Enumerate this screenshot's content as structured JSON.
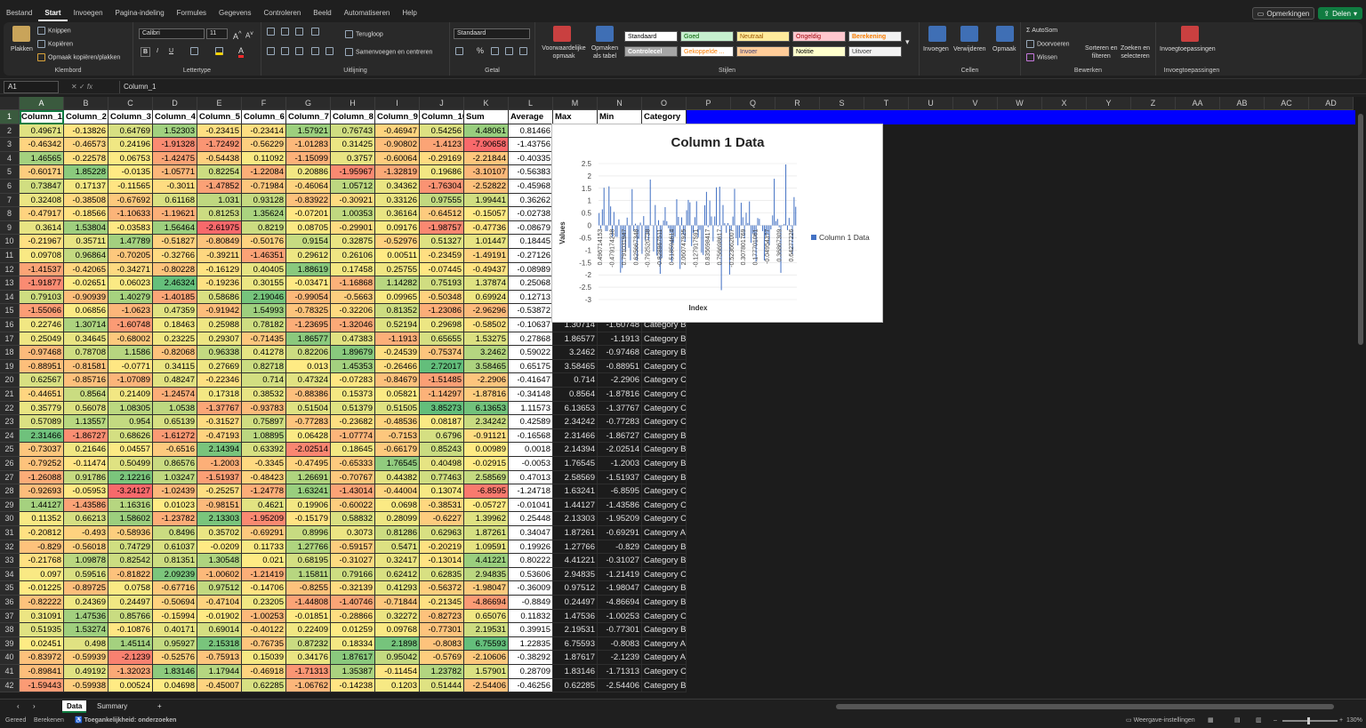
{
  "menu": {
    "tabs": [
      "Bestand",
      "Start",
      "Invoegen",
      "Pagina-indeling",
      "Formules",
      "Gegevens",
      "Controleren",
      "Beeld",
      "Automatiseren",
      "Help"
    ],
    "active": "Start",
    "comments": "Opmerkingen",
    "share": "Delen"
  },
  "ribbon": {
    "clipboard": {
      "paste": "Plakken",
      "cut": "Knippen",
      "copy": "Kopiëren",
      "format_painter": "Opmaak kopiëren/plakken",
      "label": "Klembord"
    },
    "font": {
      "name": "Calibri",
      "size": "11",
      "label": "Lettertype",
      "bold": "B",
      "italic": "I",
      "underline": "U"
    },
    "alignment": {
      "wrap": "Terugloop",
      "merge": "Samenvoegen en centreren",
      "label": "Uitlijning"
    },
    "number": {
      "format": "Standaard",
      "label": "Getal",
      "percent": "%"
    },
    "styles": {
      "cond_format": [
        "Voorwaardelijke",
        "opmaak"
      ],
      "table_format": [
        "Opmaken",
        "als tabel"
      ],
      "label": "Stijlen",
      "items": [
        "Standaard",
        "Goed",
        "Neutraal",
        "Ongeldig",
        "Berekening",
        "Controlecel",
        "Gekoppelde ...",
        "Invoer",
        "Notitie",
        "Uitvoer"
      ]
    },
    "cells": {
      "insert": "Invoegen",
      "delete": "Verwijderen",
      "format": "Opmaak",
      "label": "Cellen"
    },
    "editing": {
      "autosum": "AutoSom",
      "fill": "Doorvoeren",
      "clear": "Wissen",
      "sort": [
        "Sorteren en",
        "filteren"
      ],
      "find": [
        "Zoeken en",
        "selecteren"
      ],
      "label": "Bewerken"
    },
    "addins": {
      "name": "Invoegtoepassingen",
      "label": "Invoegtoepassingen"
    }
  },
  "formula_bar": {
    "cell_ref": "A1",
    "fx": "fx",
    "value": "Column_1"
  },
  "columns": [
    "A",
    "B",
    "C",
    "D",
    "E",
    "F",
    "G",
    "H",
    "I",
    "J",
    "K",
    "L",
    "M",
    "N",
    "O",
    "P",
    "Q",
    "R",
    "S",
    "T",
    "U",
    "V",
    "W",
    "X",
    "Y",
    "Z",
    "AA",
    "AB",
    "AC",
    "AD"
  ],
  "row_numbers": [
    1,
    2,
    3,
    4,
    5,
    6,
    7,
    8,
    9,
    10,
    11,
    12,
    13,
    14,
    15,
    16,
    17,
    18,
    19,
    20,
    21,
    22,
    23,
    24,
    25,
    26,
    27,
    28,
    29,
    30,
    31,
    32,
    33,
    34,
    35,
    36,
    37,
    38,
    39,
    40,
    41,
    42
  ],
  "headers": [
    "Column_1",
    "Column_2",
    "Column_3",
    "Column_4",
    "Column_5",
    "Column_6",
    "Column_7",
    "Column_8",
    "Column_9",
    "Column_10",
    "Sum",
    "Average",
    "Max",
    "Min",
    "Category"
  ],
  "rows": [
    [
      "0.49671",
      "-0.13826",
      "0.64769",
      "1.52303",
      "-0.23415",
      "-0.23414",
      "1.57921",
      "0.76743",
      "-0.46947",
      "0.54256",
      "4.48061",
      "0.81466",
      "",
      "",
      ""
    ],
    [
      "-0.46342",
      "-0.46573",
      "0.24196",
      "-1.91328",
      "-1.72492",
      "-0.56229",
      "-1.01283",
      "0.31425",
      "-0.90802",
      "-1.4123",
      "-7.90658",
      "-1.43756",
      "",
      "",
      ""
    ],
    [
      "1.46565",
      "-0.22578",
      "0.06753",
      "-1.42475",
      "-0.54438",
      "0.11092",
      "-1.15099",
      "0.3757",
      "-0.60064",
      "-0.29169",
      "-2.21844",
      "-0.40335",
      "",
      "",
      ""
    ],
    [
      "-0.60171",
      "1.85228",
      "-0.0135",
      "-1.05771",
      "0.82254",
      "-1.22084",
      "0.20886",
      "-1.95967",
      "-1.32819",
      "0.19686",
      "-3.10107",
      "-0.56383",
      "",
      "",
      ""
    ],
    [
      "0.73847",
      "0.17137",
      "-0.11565",
      "-0.3011",
      "-1.47852",
      "-0.71984",
      "-0.46064",
      "1.05712",
      "0.34362",
      "-1.76304",
      "-2.52822",
      "-0.45968",
      "",
      "",
      ""
    ],
    [
      "0.32408",
      "-0.38508",
      "-0.67692",
      "0.61168",
      "1.031",
      "0.93128",
      "-0.83922",
      "-0.30921",
      "0.33126",
      "0.97555",
      "1.99441",
      "0.36262",
      "",
      "",
      ""
    ],
    [
      "-0.47917",
      "-0.18566",
      "-1.10633",
      "-1.19621",
      "0.81253",
      "1.35624",
      "-0.07201",
      "1.00353",
      "0.36164",
      "-0.64512",
      "-0.15057",
      "-0.02738",
      "",
      "",
      ""
    ],
    [
      "0.3614",
      "1.53804",
      "-0.03583",
      "1.56464",
      "-2.61975",
      "0.8219",
      "0.08705",
      "-0.29901",
      "0.09176",
      "-1.98757",
      "-0.47736",
      "-0.08679",
      "",
      "",
      ""
    ],
    [
      "-0.21967",
      "0.35711",
      "1.47789",
      "-0.51827",
      "-0.80849",
      "-0.50176",
      "0.9154",
      "0.32875",
      "-0.52976",
      "0.51327",
      "1.01447",
      "0.18445",
      "",
      "",
      ""
    ],
    [
      "0.09708",
      "0.96864",
      "-0.70205",
      "-0.32766",
      "-0.39211",
      "-1.46351",
      "0.29612",
      "0.26106",
      "0.00511",
      "-0.23459",
      "-1.49191",
      "-0.27126",
      "",
      "",
      ""
    ],
    [
      "-1.41537",
      "-0.42065",
      "-0.34271",
      "-0.80228",
      "-0.16129",
      "0.40405",
      "1.88619",
      "0.17458",
      "0.25755",
      "-0.07445",
      "-0.49437",
      "-0.08989",
      "",
      "",
      ""
    ],
    [
      "-1.91877",
      "-0.02651",
      "0.06023",
      "2.46324",
      "-0.19236",
      "0.30155",
      "-0.03471",
      "-1.16868",
      "1.14282",
      "0.75193",
      "1.37874",
      "0.25068",
      "",
      "",
      ""
    ],
    [
      "0.79103",
      "-0.90939",
      "1.40279",
      "-1.40185",
      "0.58686",
      "2.19046",
      "-0.99054",
      "-0.5663",
      "0.09965",
      "-0.50348",
      "0.69924",
      "0.12713",
      "",
      "",
      ""
    ],
    [
      "-1.55066",
      "0.06856",
      "-1.0623",
      "0.47359",
      "-0.91942",
      "1.54993",
      "-0.78325",
      "-0.32206",
      "0.81352",
      "-1.23086",
      "-2.96296",
      "-0.53872",
      "",
      "",
      ""
    ],
    [
      "0.22746",
      "1.30714",
      "-1.60748",
      "0.18463",
      "0.25988",
      "0.78182",
      "-1.23695",
      "-1.32046",
      "0.52194",
      "0.29698",
      "-0.58502",
      "-0.10637",
      "1.30714",
      "-1.60748",
      "Category B"
    ],
    [
      "0.25049",
      "0.34645",
      "-0.68002",
      "0.23225",
      "0.29307",
      "-0.71435",
      "1.86577",
      "0.47383",
      "-1.1913",
      "0.65655",
      "1.53275",
      "0.27868",
      "1.86577",
      "-1.1913",
      "Category B"
    ],
    [
      "-0.97468",
      "0.78708",
      "1.1586",
      "-0.82068",
      "0.96338",
      "0.41278",
      "0.82206",
      "1.89679",
      "-0.24539",
      "-0.75374",
      "3.2462",
      "0.59022",
      "3.2462",
      "-0.97468",
      "Category B"
    ],
    [
      "-0.88951",
      "-0.81581",
      "-0.0771",
      "0.34115",
      "0.27669",
      "0.82718",
      "0.013",
      "1.45353",
      "-0.26466",
      "2.72017",
      "3.58465",
      "0.65175",
      "3.58465",
      "-0.88951",
      "Category C"
    ],
    [
      "0.62567",
      "-0.85716",
      "-1.07089",
      "0.48247",
      "-0.22346",
      "0.714",
      "0.47324",
      "-0.07283",
      "-0.84679",
      "-1.51485",
      "-2.2906",
      "-0.41647",
      "0.714",
      "-2.2906",
      "Category C"
    ],
    [
      "-0.44651",
      "0.8564",
      "0.21409",
      "-1.24574",
      "0.17318",
      "0.38532",
      "-0.88386",
      "0.15373",
      "0.05821",
      "-1.14297",
      "-1.87816",
      "-0.34148",
      "0.8564",
      "-1.87816",
      "Category C"
    ],
    [
      "0.35779",
      "0.56078",
      "1.08305",
      "1.0538",
      "-1.37767",
      "-0.93783",
      "0.51504",
      "0.51379",
      "0.51505",
      "3.85273",
      "6.13653",
      "1.11573",
      "6.13653",
      "-1.37767",
      "Category C"
    ],
    [
      "0.57089",
      "1.13557",
      "0.954",
      "0.65139",
      "-0.31527",
      "0.75897",
      "-0.77283",
      "-0.23682",
      "-0.48536",
      "0.08187",
      "2.34242",
      "0.42589",
      "2.34242",
      "-0.77283",
      "Category C"
    ],
    [
      "2.31466",
      "-1.86727",
      "0.68626",
      "-1.61272",
      "-0.47193",
      "1.08895",
      "0.06428",
      "-1.07774",
      "-0.7153",
      "0.6796",
      "-0.91121",
      "-0.16568",
      "2.31466",
      "-1.86727",
      "Category B"
    ],
    [
      "-0.73037",
      "0.21646",
      "0.04557",
      "-0.6516",
      "2.14394",
      "0.63392",
      "-2.02514",
      "0.18645",
      "-0.66179",
      "0.85243",
      "0.00989",
      "0.0018",
      "2.14394",
      "-2.02514",
      "Category B"
    ],
    [
      "-0.79252",
      "-0.11474",
      "0.50499",
      "0.86576",
      "-1.2003",
      "-0.3345",
      "-0.47495",
      "-0.65333",
      "1.76545",
      "0.40498",
      "-0.02915",
      "-0.0053",
      "1.76545",
      "-1.2003",
      "Category B"
    ],
    [
      "-1.26088",
      "0.91786",
      "2.12216",
      "1.03247",
      "-1.51937",
      "-0.48423",
      "1.26691",
      "-0.70767",
      "0.44382",
      "0.77463",
      "2.58569",
      "0.47013",
      "2.58569",
      "-1.51937",
      "Category B"
    ],
    [
      "-0.92693",
      "-0.05953",
      "-3.24127",
      "-1.02439",
      "-0.25257",
      "-1.24778",
      "1.63241",
      "-1.43014",
      "-0.44004",
      "0.13074",
      "-6.8595",
      "-1.24718",
      "1.63241",
      "-6.8595",
      "Category C"
    ],
    [
      "1.44127",
      "-1.43586",
      "1.16316",
      "0.01023",
      "-0.98151",
      "0.4621",
      "0.19906",
      "-0.60022",
      "0.0698",
      "-0.38531",
      "-0.05727",
      "-0.01041",
      "1.44127",
      "-1.43586",
      "Category C"
    ],
    [
      "0.11352",
      "0.66213",
      "1.58602",
      "-1.23782",
      "2.13303",
      "-1.95209",
      "-0.15179",
      "0.58832",
      "0.28099",
      "-0.6227",
      "1.39962",
      "0.25448",
      "2.13303",
      "-1.95209",
      "Category C"
    ],
    [
      "-0.20812",
      "-0.493",
      "-0.58936",
      "0.8496",
      "0.35702",
      "-0.69291",
      "0.8996",
      "0.3073",
      "0.81286",
      "0.62963",
      "1.87261",
      "0.34047",
      "1.87261",
      "-0.69291",
      "Category A"
    ],
    [
      "-0.829",
      "-0.56018",
      "0.74729",
      "0.61037",
      "-0.0209",
      "0.11733",
      "1.27766",
      "-0.59157",
      "0.5471",
      "-0.20219",
      "1.09591",
      "0.19926",
      "1.27766",
      "-0.829",
      "Category B"
    ],
    [
      "-0.21768",
      "1.09878",
      "0.82542",
      "0.81351",
      "1.30548",
      "0.021",
      "0.68195",
      "-0.31027",
      "0.32417",
      "-0.13014",
      "4.41221",
      "0.80222",
      "4.41221",
      "-0.31027",
      "Category B"
    ],
    [
      "0.097",
      "0.59516",
      "-0.81822",
      "2.09239",
      "-1.00602",
      "-1.21419",
      "1.15811",
      "0.79166",
      "0.62412",
      "0.62835",
      "2.94835",
      "0.53606",
      "2.94835",
      "-1.21419",
      "Category C"
    ],
    [
      "-0.01225",
      "-0.89725",
      "0.0758",
      "-0.67716",
      "0.97512",
      "-0.14706",
      "-0.8255",
      "-0.32139",
      "0.41293",
      "-0.56372",
      "-1.98047",
      "-0.36009",
      "0.97512",
      "-1.98047",
      "Category B"
    ],
    [
      "-0.82222",
      "0.24369",
      "0.24497",
      "-0.50694",
      "-0.47104",
      "0.23205",
      "-1.44808",
      "-1.40746",
      "-0.71844",
      "-0.21345",
      "-4.86694",
      "-0.8849",
      "0.24497",
      "-4.86694",
      "Category B"
    ],
    [
      "0.31091",
      "1.47536",
      "0.85766",
      "-0.15994",
      "-0.01902",
      "-1.00253",
      "-0.01851",
      "-0.28866",
      "0.32272",
      "-0.82723",
      "0.65076",
      "0.11832",
      "1.47536",
      "-1.00253",
      "Category C"
    ],
    [
      "0.51935",
      "1.53274",
      "-0.10876",
      "0.40171",
      "0.69014",
      "-0.40122",
      "0.22409",
      "0.01259",
      "0.09768",
      "-0.77301",
      "2.19531",
      "0.39915",
      "2.19531",
      "-0.77301",
      "Category B"
    ],
    [
      "0.02451",
      "0.498",
      "1.45114",
      "0.95927",
      "2.15318",
      "-0.76735",
      "0.87232",
      "0.18334",
      "2.1898",
      "-0.8083",
      "6.75593",
      "1.22835",
      "6.75593",
      "-0.8083",
      "Category A"
    ],
    [
      "-0.83972",
      "-0.59939",
      "-2.1239",
      "-0.52576",
      "-0.75913",
      "0.15039",
      "0.34176",
      "1.87617",
      "0.95042",
      "-0.5769",
      "-2.10606",
      "-0.38292",
      "1.87617",
      "-2.1239",
      "Category A"
    ],
    [
      "-0.89841",
      "0.49192",
      "-1.32023",
      "1.83146",
      "1.17944",
      "-0.46918",
      "-1.71313",
      "1.35387",
      "-0.11454",
      "1.23782",
      "1.57901",
      "0.28709",
      "1.83146",
      "-1.71313",
      "Category C"
    ],
    [
      "-1.59443",
      "-0.59938",
      "0.00524",
      "0.04698",
      "-0.45007",
      "0.62285",
      "-1.06762",
      "-0.14238",
      "0.1203",
      "0.51444",
      "-2.54406",
      "-0.46256",
      "0.62285",
      "-2.54406",
      "Category B"
    ]
  ],
  "chart_data": {
    "type": "bar",
    "title": "Column 1 Data",
    "xlabel": "Index",
    "ylabel": "Values",
    "ylim": [
      -3,
      2.5
    ],
    "yticks": [
      "2.5",
      "2",
      "1.5",
      "1",
      "0.5",
      "0",
      "-0.5",
      "-1",
      "-1.5",
      "-2",
      "-2.5",
      "-3"
    ],
    "tick_labels": [
      "0.496714153",
      "-0.479174238",
      "0.791031947",
      "0.625667348",
      "-0.792520738",
      "-0.828967511",
      "0.518594614",
      "2.060747925",
      "-0.127917591",
      "0.835698417",
      "0.756698617",
      "-0.523662007",
      "0.307801769",
      "0.177701061",
      "-0.04954377",
      "0.36867309",
      "0.64277226"
    ],
    "series": [
      {
        "name": "Column 1 Data",
        "values": [
          0.497,
          -0.138,
          0.648,
          1.523,
          -0.234,
          -0.234,
          1.579,
          0.767,
          -0.469,
          0.543,
          -0.463,
          -0.466,
          0.242,
          -1.913,
          -1.725,
          -0.562,
          -1.013,
          0.314,
          -0.908,
          -1.412,
          1.466,
          -0.226,
          0.068,
          -1.425,
          -0.544,
          0.111,
          -1.151,
          0.376,
          -0.601,
          -0.292,
          -0.602,
          1.852,
          -0.014,
          -1.058,
          0.823,
          -1.221,
          0.209,
          -1.96,
          -1.328,
          0.197,
          0.738,
          0.171,
          -0.116,
          -0.301,
          -1.479,
          -0.72,
          -0.461,
          1.057,
          0.344,
          -1.763,
          0.324,
          -0.385,
          -0.677,
          0.612,
          1.031,
          0.931,
          -0.839,
          -0.309,
          0.331,
          0.976,
          -0.479,
          -0.186,
          -1.106,
          -1.196,
          0.813,
          1.356,
          -0.072,
          1.004,
          0.362,
          -0.645,
          0.361,
          1.538,
          -0.036,
          1.565,
          -2.62,
          0.822,
          0.087,
          -0.299,
          0.092,
          -1.988,
          -0.22,
          0.357,
          1.478,
          -0.518,
          -0.808,
          -0.502,
          0.915,
          0.329,
          -0.53,
          0.513,
          0.097,
          0.969,
          -0.702,
          -0.328,
          -0.392,
          -1.464,
          0.296,
          0.261,
          0.005,
          -0.235,
          -1.415,
          -0.421,
          -0.343,
          -0.802,
          -0.161,
          0.404,
          1.886,
          0.175,
          0.258,
          -0.074,
          -1.919,
          -0.027,
          0.06,
          2.463,
          -0.192,
          0.302,
          -0.035,
          -1.169,
          1.143,
          0.752
        ]
      }
    ],
    "legend": "right",
    "grid": true
  },
  "sheets": {
    "tabs": [
      "Data",
      "Summary"
    ],
    "active": "Data",
    "add": "+"
  },
  "status": {
    "ready": "Gereed",
    "calculate": "Berekenen",
    "accessibility": "Toegankelijkheid: onderzoeken",
    "view_settings": "Weergave-instellingen",
    "zoom": "130%"
  }
}
